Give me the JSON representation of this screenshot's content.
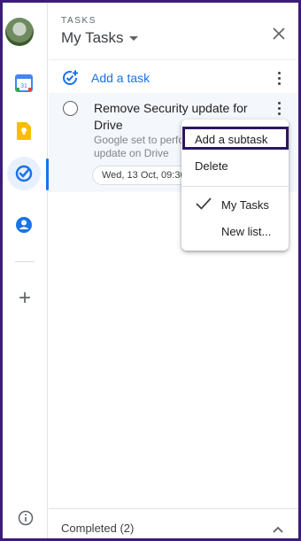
{
  "header": {
    "eyebrow": "TASKS",
    "list_title": "My Tasks"
  },
  "add_task": {
    "label": "Add a task"
  },
  "task": {
    "title": "Remove Security update for Drive",
    "notes_line1": "Google set to perfo",
    "notes_line2": "update on Drive",
    "date": "Wed, 13 Oct, 09:30"
  },
  "menu": {
    "items": [
      {
        "label": "Add a subtask"
      },
      {
        "label": "Delete"
      },
      {
        "label": "My Tasks"
      },
      {
        "label": "New list..."
      }
    ]
  },
  "footer": {
    "completed_label": "Completed (2)"
  },
  "rail": {
    "icons": [
      "calendar-icon",
      "keep-icon",
      "tasks-icon",
      "contacts-icon",
      "add-icon",
      "info-icon"
    ]
  },
  "colors": {
    "accent": "#1a73e8",
    "frame": "#3a1d7a",
    "highlight_border": "#2e1660"
  }
}
